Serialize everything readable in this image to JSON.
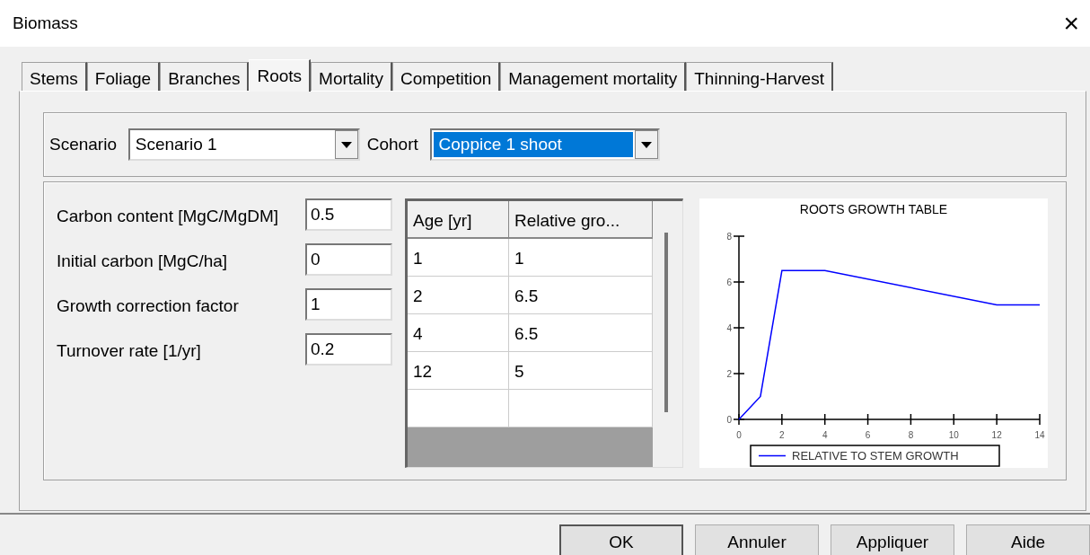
{
  "window": {
    "title": "Biomass",
    "close": "×"
  },
  "tabs": [
    {
      "label": "Stems",
      "selected": false
    },
    {
      "label": "Foliage",
      "selected": false
    },
    {
      "label": "Branches",
      "selected": false
    },
    {
      "label": "Roots",
      "selected": true
    },
    {
      "label": "Mortality",
      "selected": false
    },
    {
      "label": "Competition",
      "selected": false
    },
    {
      "label": "Management mortality",
      "selected": false
    },
    {
      "label": "Thinning-Harvest",
      "selected": false
    }
  ],
  "selectors": [
    {
      "label": "Scenario",
      "value": "Scenario 1",
      "highlighted": false
    },
    {
      "label": "Cohort",
      "value": "Coppice 1 shoot",
      "highlighted": true
    }
  ],
  "fields": [
    {
      "label": "Carbon content [MgC/MgDM]",
      "value": "0.5"
    },
    {
      "label": "Initial carbon [MgC/ha]",
      "value": "0"
    },
    {
      "label": "Growth correction factor",
      "value": "1"
    },
    {
      "label": "Turnover rate [1/yr]",
      "value": "0.2"
    }
  ],
  "table": {
    "columns": [
      "Age [yr]",
      "Relative gro..."
    ],
    "rows": [
      [
        "1",
        "1"
      ],
      [
        "2",
        "6.5"
      ],
      [
        "4",
        "6.5"
      ],
      [
        "12",
        "5"
      ]
    ]
  },
  "chart": {
    "chart_data": {
      "type": "line",
      "title": "ROOTS GROWTH TABLE",
      "x": [
        0,
        1,
        2,
        4,
        12,
        14
      ],
      "series": [
        {
          "name": "RELATIVE TO STEM GROWTH",
          "color": "#0000ff",
          "values": [
            0,
            1,
            6.5,
            6.5,
            5,
            5
          ]
        }
      ],
      "xlim": [
        0,
        14
      ],
      "ylim": [
        0,
        8
      ],
      "xticks": [
        0,
        2,
        4,
        6,
        8,
        10,
        12,
        14
      ],
      "yticks": [
        0,
        2,
        4,
        6,
        8
      ]
    }
  },
  "buttons": [
    "OK",
    "Annuler",
    "Appliquer",
    "Aide"
  ]
}
